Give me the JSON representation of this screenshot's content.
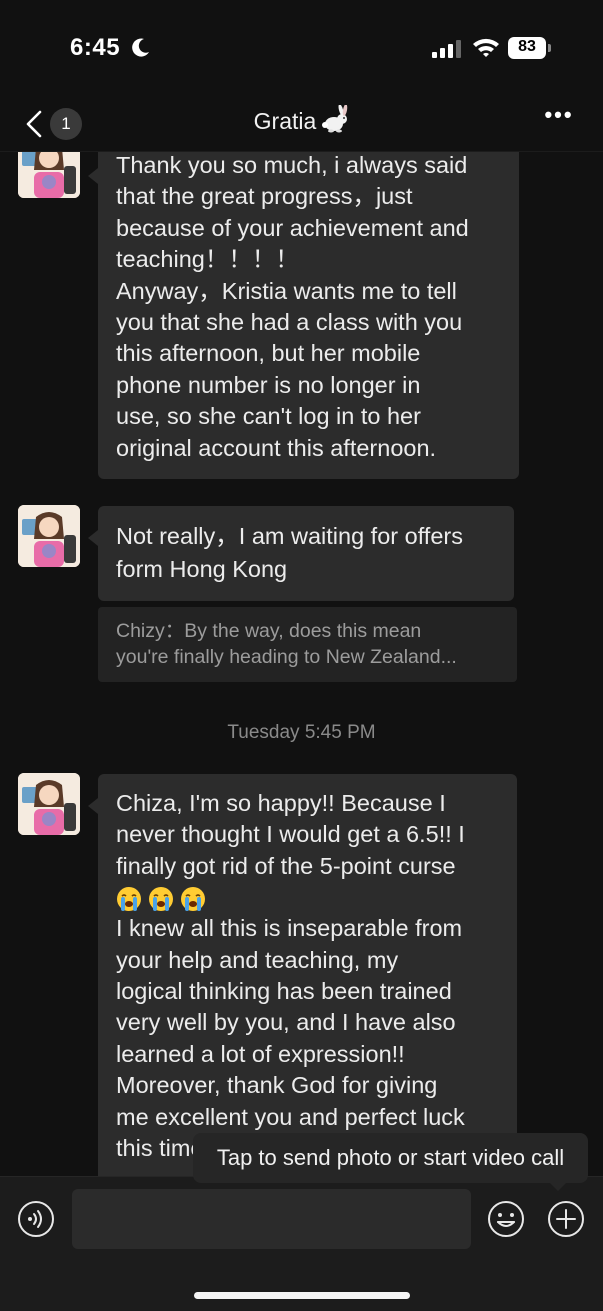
{
  "status_bar": {
    "time": "6:45",
    "battery": "83",
    "icons": [
      "moon-icon",
      "cellular-signal-icon",
      "wifi-icon",
      "battery-icon"
    ]
  },
  "nav": {
    "back_icon": "chevron-left-icon",
    "unread_count": "1",
    "title": "Gratia",
    "title_emoji": "rabbit-icon",
    "more_label": "•••"
  },
  "messages": [
    {
      "sender": "contact",
      "lines": [
        "Thank you so much, i always said",
        "that the great progress，just",
        "because of your achievement and",
        "teaching！！！！",
        "Anyway，Kristia wants me to tell",
        "you that she had a class with you",
        "this afternoon, but her mobile",
        "phone number is no longer in",
        "use, so she can't log in to her",
        "original account this afternoon."
      ]
    },
    {
      "sender": "contact",
      "lines": [
        "Not really，I am waiting for offers",
        "form Hong Kong"
      ],
      "quote_lines": [
        "Chizy：By the way, does this mean",
        "you're finally heading to New Zealand..."
      ]
    },
    {
      "sender": "contact",
      "timestamp": "Tuesday 5:45 PM",
      "lines_before_emoji": [
        "Chiza, I'm so happy!! Because I",
        "never thought I would get a 6.5!! I",
        "finally got rid of the 5-point curse"
      ],
      "emojis": [
        "crying-face-emoji",
        "crying-face-emoji",
        "crying-face-emoji"
      ],
      "lines_after_emoji": [
        "I knew all this is inseparable from",
        "your help and teaching, my",
        "logical thinking has been trained",
        "very well by you, and I have also",
        "learned a lot of expression!!",
        "Moreover, thank God for giving",
        "me excellent you and perfect luck",
        "this time!"
      ]
    }
  ],
  "tooltip": {
    "text": "Tap to send photo or start video call"
  },
  "input_bar": {
    "icons": [
      "voice-icon",
      "emoji-icon",
      "plus-icon"
    ],
    "value": "",
    "placeholder": ""
  },
  "colors": {
    "background": "#111111",
    "bubble": "#2c2c2c",
    "quote": "#232323",
    "text": "#ececec",
    "muted_text": "#9c9c9c"
  }
}
